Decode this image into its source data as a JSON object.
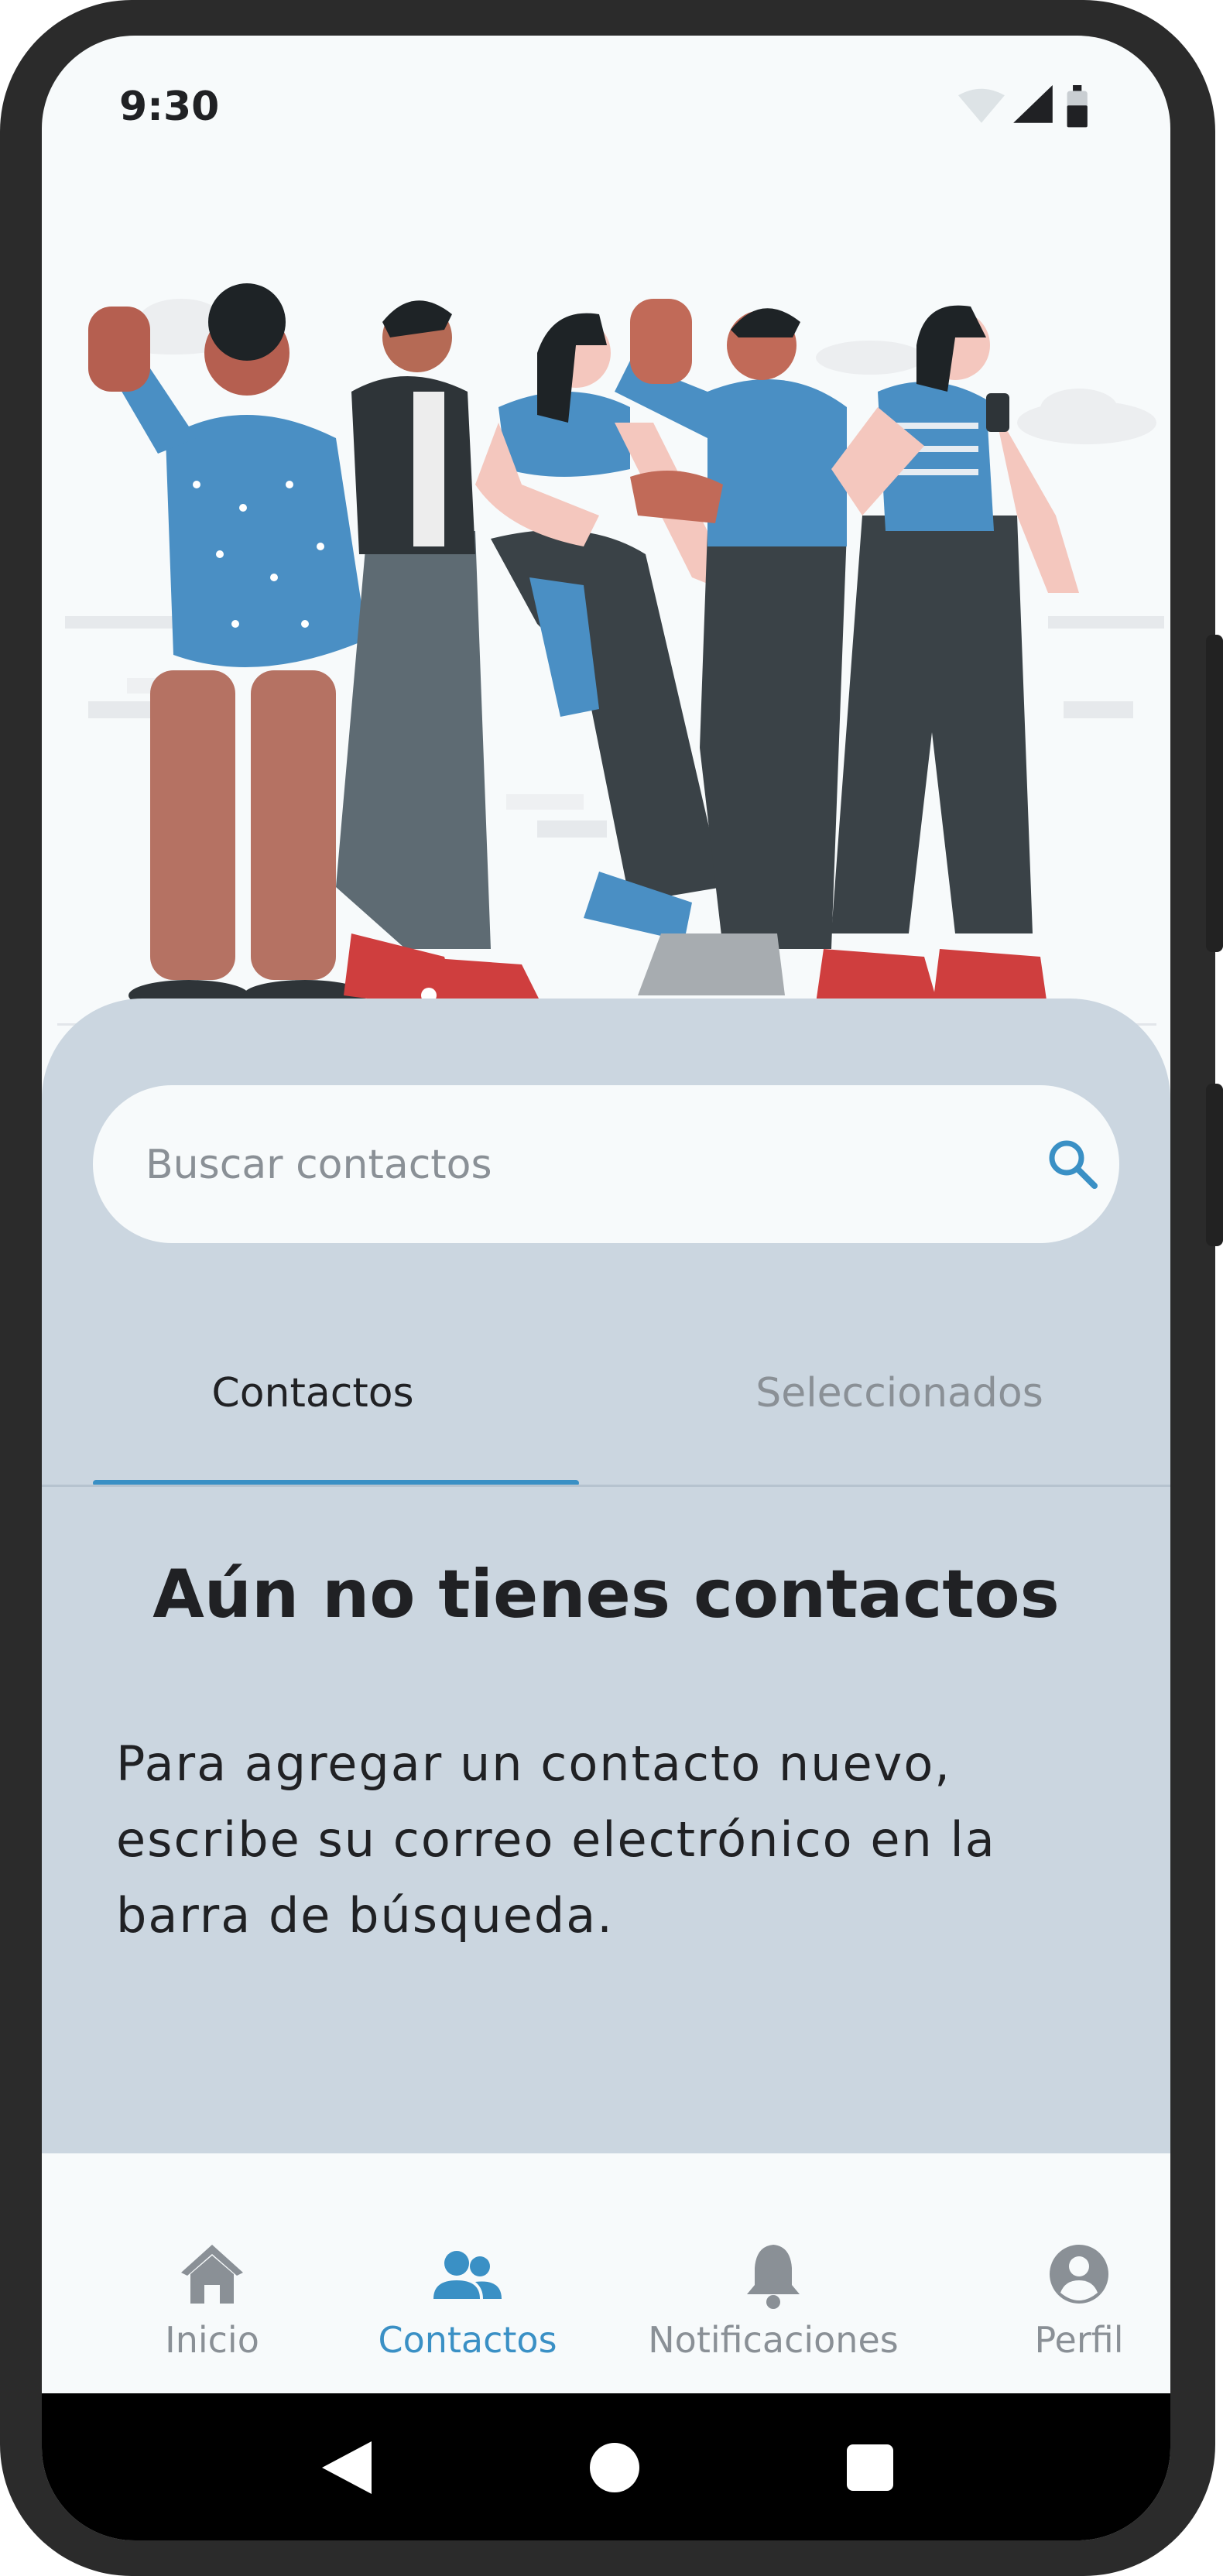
{
  "status_bar": {
    "time": "9:30",
    "icons": [
      "wifi-icon",
      "signal-icon",
      "battery-icon"
    ]
  },
  "search": {
    "placeholder": "Buscar contactos",
    "icon": "search-icon"
  },
  "tabs": [
    {
      "label": "Contactos",
      "active": true
    },
    {
      "label": "Seleccionados",
      "active": false
    }
  ],
  "empty_state": {
    "title": "Aún no tienes contactos",
    "description": "Para agregar un contacto nuevo, escribe su correo electrónico en la barra de búsqueda."
  },
  "bottom_nav": [
    {
      "label": "Inicio",
      "icon": "home-icon",
      "active": false
    },
    {
      "label": "Contactos",
      "icon": "contacts-icon",
      "active": true
    },
    {
      "label": "Notificaciones",
      "icon": "bell-icon",
      "active": false
    },
    {
      "label": "Perfil",
      "icon": "profile-icon",
      "active": false
    }
  ],
  "system_nav": [
    "back-icon",
    "home-circle-icon",
    "recents-icon"
  ],
  "colors": {
    "accent": "#3A90C5",
    "panel": "#CBD6E0",
    "surface": "#F7FAFB",
    "text": "#202124",
    "muted": "#8A9096"
  }
}
